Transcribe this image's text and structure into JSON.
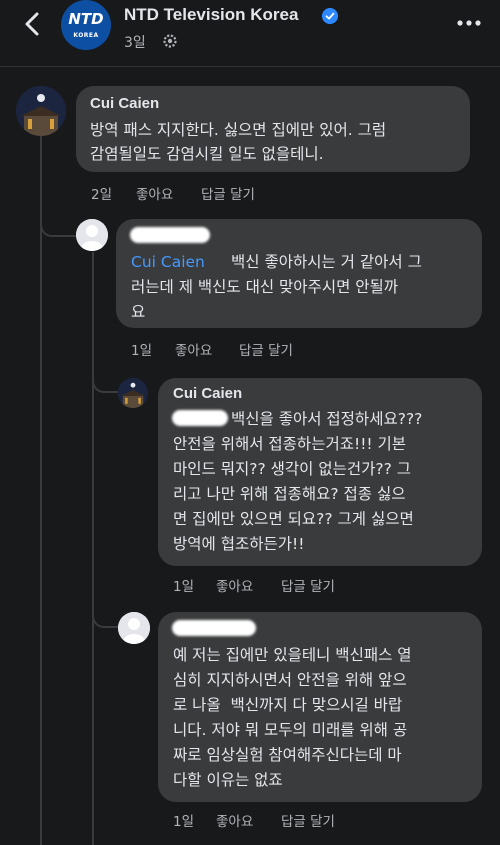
{
  "header": {
    "page_name": "NTD Television Korea",
    "post_time": "3일",
    "logo_text": "NTD",
    "logo_subtext": "KOREA"
  },
  "comments": [
    {
      "author": "Cui Caien",
      "lines": [
        "방역 패스 지지한다. 싫으면 집에만 있어. 그럼",
        "감염될일도 감염시킬 일도 없을테니."
      ],
      "time": "2일",
      "like": "좋아요",
      "reply": "답글 달기"
    },
    {
      "author": "",
      "mention": "Cui Caien",
      "lines": [
        "백신 좋아하시는 거 같아서 그",
        "러는데 제 백신도 대신 맞아주시면 안될까",
        "요"
      ],
      "time": "1일",
      "like": "좋아요",
      "reply": "답글 달기"
    },
    {
      "author": "Cui Caien",
      "lines": [
        "백신을 좋아서 접정하세요???",
        "안전을 위해서 접종하는거죠!!! 기본",
        "마인드 뭐지?? 생각이 없는건가?? 그",
        "리고 나만 위해 접종해요? 접종 싫으",
        "면 집에만 있으면 되요?? 그게 싫으면",
        "방역에 협조하든가!!"
      ],
      "time": "1일",
      "like": "좋아요",
      "reply": "답글 달기"
    },
    {
      "author": "",
      "lines": [
        "예 저는 집에만 있을테니 백신패스 열",
        "심히 지지하시면서 안전을 위해 앞으",
        "로 나올  백신까지 다 맞으시길 바랍",
        "니다. 저야 뭐 모두의 미래를 위해 공",
        "짜로 임상실험 참여해주신다는데 마",
        "다할 이유는 없죠"
      ],
      "time": "1일",
      "like": "좋아요",
      "reply": "답글 달기"
    }
  ]
}
